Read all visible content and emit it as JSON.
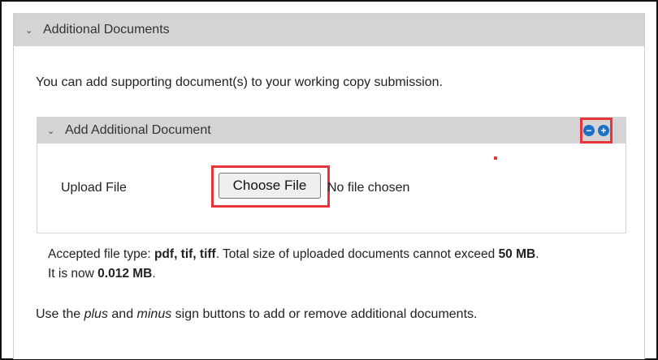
{
  "panel": {
    "title": "Additional Documents",
    "intro": "You can add supporting document(s) to your working copy submission."
  },
  "subpanel": {
    "title": "Add Additional Document",
    "remove_icon": "minus-circle-icon",
    "add_icon": "plus-circle-icon"
  },
  "upload": {
    "label": "Upload File",
    "button_label": "Choose File",
    "file_status": "No file chosen"
  },
  "accepted": {
    "prefix": "Accepted file type: ",
    "types": "pdf, tif, tiff",
    "middle": ". Total size of uploaded documents cannot exceed ",
    "limit": "50 MB",
    "end1": ".",
    "now_prefix": "It is now ",
    "current": "0.012 MB",
    "end2": "."
  },
  "hint": {
    "prefix": "Use the ",
    "plus": "plus",
    "and": " and ",
    "minus": "minus",
    "suffix": " sign buttons to add or remove additional documents."
  },
  "colors": {
    "highlight": "#e8343b",
    "button_blue": "#1f6fc7",
    "header_gray": "#d4d4d4"
  }
}
